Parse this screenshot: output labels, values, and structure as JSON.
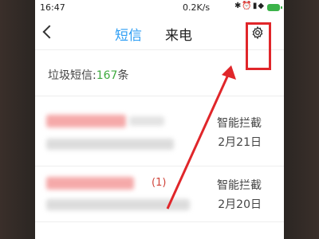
{
  "status_bar": {
    "time": "16:47",
    "net_rate": "0.2K/s",
    "icons": [
      "bluetooth-icon",
      "alarm-icon",
      "signal-icon",
      "wifi-icon",
      "battery-icon"
    ]
  },
  "header": {
    "tabs": [
      {
        "label": "短信",
        "active": true
      },
      {
        "label": "来电",
        "active": false
      }
    ],
    "settings_icon": "gear-icon"
  },
  "spam": {
    "label": "垃圾短信:",
    "count": "167",
    "unit": "条"
  },
  "messages": [
    {
      "tag": "智能拦截",
      "date": "2月21日",
      "unread_count": ""
    },
    {
      "tag": "智能拦截",
      "date": "2月20日",
      "unread_count": "(1)"
    }
  ],
  "colors": {
    "accent": "#2b9df4",
    "spam_count": "#3faa3f",
    "annotation": "#e0262a"
  }
}
